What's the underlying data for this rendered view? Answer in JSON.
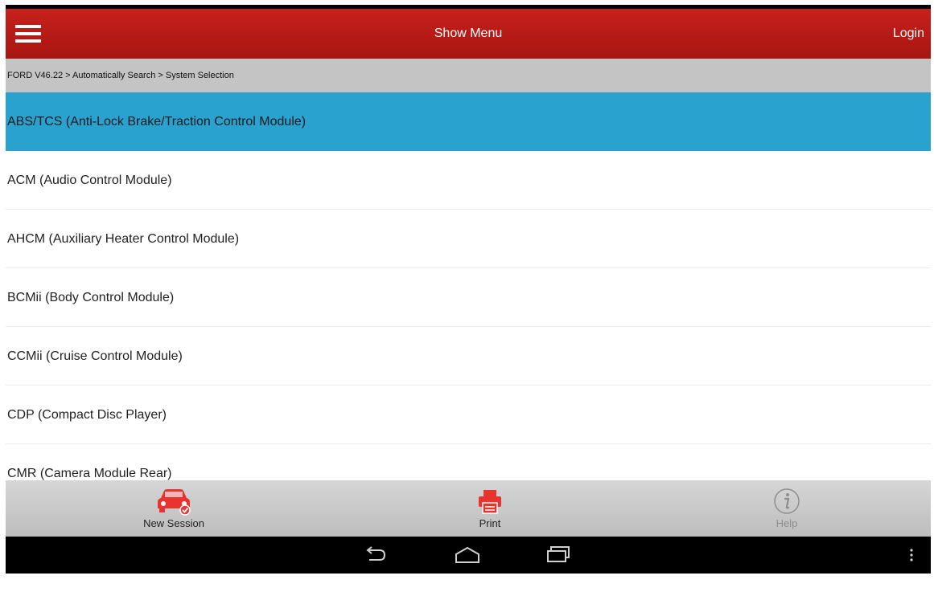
{
  "header": {
    "title": "Show Menu",
    "login_label": "Login",
    "bg_color": "#b71a16"
  },
  "breadcrumb": {
    "text": "FORD V46.22 > Automatically Search > System Selection"
  },
  "list": {
    "selected_color": "#2aa2cf",
    "items": [
      {
        "label": "ABS/TCS (Anti-Lock Brake/Traction Control Module)",
        "selected": true
      },
      {
        "label": "ACM (Audio Control Module)",
        "selected": false
      },
      {
        "label": "AHCM (Auxiliary Heater Control Module)",
        "selected": false
      },
      {
        "label": "BCMii (Body Control Module)",
        "selected": false
      },
      {
        "label": "CCMii (Cruise Control Module)",
        "selected": false
      },
      {
        "label": "CDP (Compact Disc Player)",
        "selected": false
      },
      {
        "label": "CMR (Camera Module Rear)",
        "selected": false
      }
    ]
  },
  "toolbar": {
    "new_session_label": "New Session",
    "new_session_icon": "car-icon",
    "print_label": "Print",
    "print_icon": "printer-icon",
    "help_label": "Help",
    "help_icon": "info-icon",
    "accent_color": "#e8332e"
  },
  "navbar": {
    "back_icon": "back-icon",
    "home_icon": "home-icon",
    "recents_icon": "recent-apps-icon",
    "menu_icon": "overflow-menu-icon"
  }
}
